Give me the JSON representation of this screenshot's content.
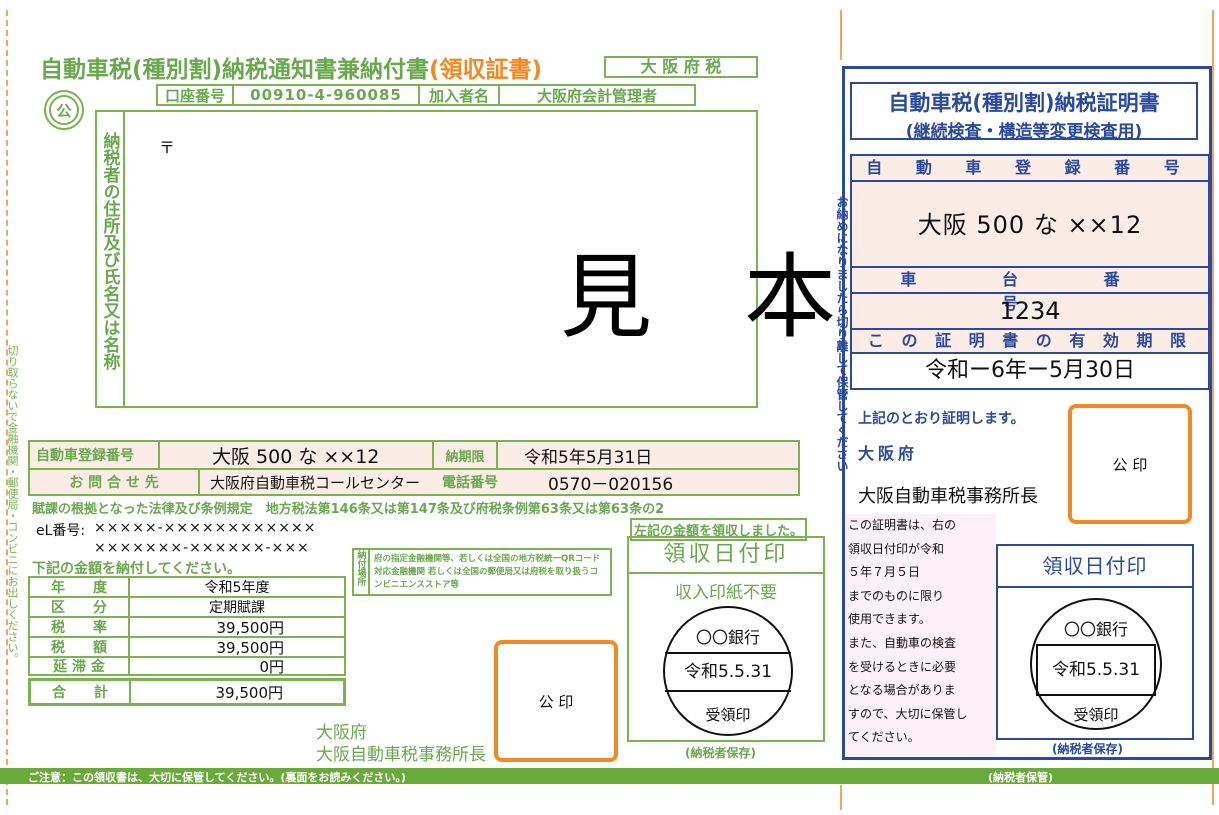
{
  "left": {
    "title_main": "自動車税(種別割)納税通知書兼納付書",
    "title_receipt": "(領収証書)",
    "pref_tax": "大 阪 府 税",
    "kou": "公",
    "account_label": "口座番号",
    "account_number": "00910-4-960085",
    "subscriber_label": "加入者名",
    "subscriber_name": "大阪府会計管理者",
    "addr_label": "納税者の住所及び氏名又は名称",
    "postal_mark": "〒",
    "mihon": "見　本",
    "reg_label": "自動車登録番号",
    "reg_value": "大阪 500 な ××12",
    "deadline_label": "納期限",
    "deadline_value": "令和5年5月31日",
    "inquiry_label": "お 問 合 せ 先",
    "inquiry_value": "大阪府自動車税コールセンター",
    "phone_label": "電話番号",
    "phone_value": "0570－020156",
    "law_text": "賦課の根拠となった法律及び条例規定　地方税法第146条又は第147条及び府税条例第63条又は第63条の2",
    "el_label": "eL番号:",
    "el_line1": "×××××-××××××××××××",
    "el_line2": "×××××××-××××××-×××",
    "pay_instruction": "下記の金額を納付してください。",
    "rows": [
      {
        "label": "年　　度",
        "value": "令和5年度"
      },
      {
        "label": "区　　分",
        "value": "定期賦課"
      },
      {
        "label": "税　　率",
        "value": "39,500円"
      },
      {
        "label": "税　　額",
        "value": "39,500円"
      },
      {
        "label": "延 滞 金",
        "value": "0円"
      }
    ],
    "total_label": "合　　計",
    "total_value": "39,500円",
    "payplace_label": "納付場所",
    "payplace_text": "府の指定金融機関等、若しくは全国の地方税統一QRコード対応金融機関 若しくは全国の郵便局又は府税を取り扱うコンビニエンスストア等",
    "seal_label": "公 印",
    "issuer_pref": "大阪府",
    "issuer_name": "大阪自動車税事務所長",
    "received_note": "左記の金額を領収しました。",
    "receipt_date_title": "領収日付印",
    "stamp_free": "収入印紙不要",
    "bank": "〇〇銀行",
    "stamp_date": "令和5.5.31",
    "stamp_received": "受領印",
    "taxpayer_keep": "(納税者保存)",
    "cut_note": "切り取らないで金融機関・郵便局・コンビニにお出しください。",
    "footer_note": "ご注意：この領収書は、大切に保管してください。(裏面をお読みください。)"
  },
  "right": {
    "title1": "自動車税(種別割)納税証明書",
    "title2": "(継続検査・構造等変更検査用)",
    "reg_header": "自 動 車 登 録 番 号",
    "reg_value": "大阪 500 な ××12",
    "chassis_header": "車 台 番 号",
    "chassis_value": "1234",
    "validity_header": "こ の 証 明 書 の 有 効 期 限",
    "validity_value": "令和ー6年ー5月30日",
    "certify": "上記のとおり証明します。",
    "pref": "大阪府",
    "office": "大阪自動車税事務所長",
    "seal_label": "公 印",
    "vertical_note": "お納めになりましたら切り離して保管してください",
    "notice": [
      "この証明書は、右の",
      "領収日付印が令和",
      "５年７月５日",
      "までのものに限り",
      "使用できます。",
      "また、自動車の検査",
      "を受けるときに必要",
      "となる場合がありま",
      "すので、大切に保管し",
      "てください。"
    ],
    "receipt_date_title": "領収日付印",
    "bank": "〇〇銀行",
    "stamp_date": "令和5.5.31",
    "stamp_received": "受領印",
    "taxpayer_keep": "(納税者保存)",
    "footer_keep": "(納税者保管)"
  },
  "colors": {
    "green": "#7ab34f",
    "orange": "#f08a24",
    "blue": "#2b4a9b",
    "pink": "#fbece6"
  }
}
